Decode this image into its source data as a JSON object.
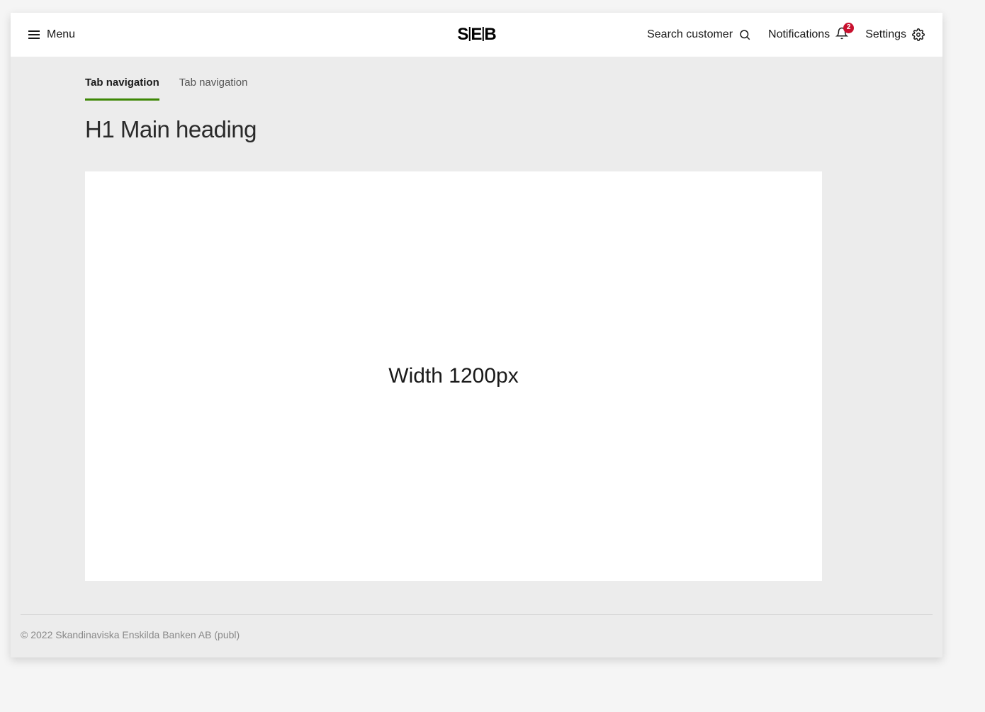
{
  "header": {
    "menu_label": "Menu",
    "logo": "S|E|B",
    "actions": {
      "search_label": "Search customer",
      "notifications_label": "Notifications",
      "notifications_badge": "2",
      "settings_label": "Settings"
    }
  },
  "tabs": [
    {
      "label": "Tab navigation",
      "active": true
    },
    {
      "label": "Tab navigation",
      "active": false
    }
  ],
  "main": {
    "heading": "H1 Main heading",
    "card_text": "Width 1200px"
  },
  "footer": {
    "copyright": "© 2022 Skandinaviska Enskilda Banken AB (publ)"
  }
}
